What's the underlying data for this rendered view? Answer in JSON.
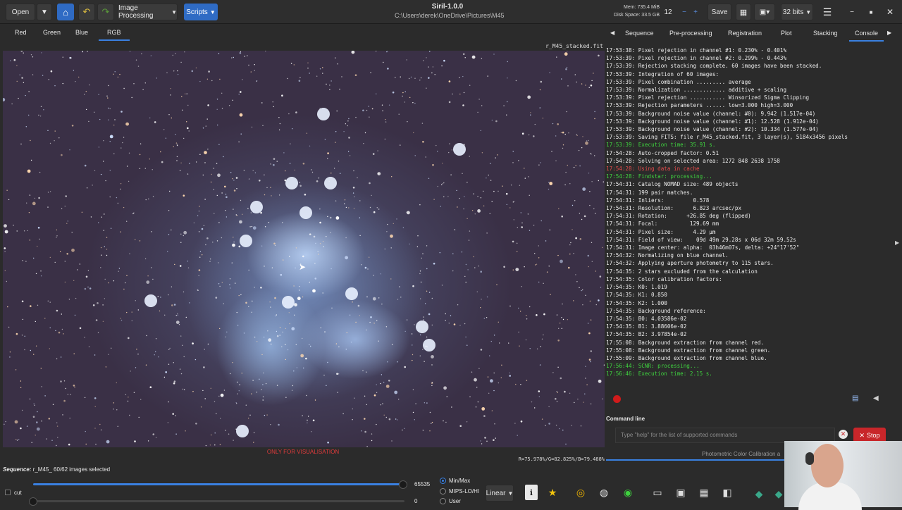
{
  "toolbar": {
    "open_label": "Open",
    "image_processing_label": "Image Processing",
    "scripts_label": "Scripts",
    "app_title": "Siril-1.0.0",
    "file_path": "C:\\Users\\derek\\OneDrive\\Pictures\\M45",
    "mem": "Mem: 735.4 MiB",
    "disk": "Disk Space: 33.5 GB",
    "threads": "12",
    "save_label": "Save",
    "bits_label": "32 bits"
  },
  "channel_tabs": [
    "Red",
    "Green",
    "Blue",
    "RGB"
  ],
  "right_tabs": [
    "Sequence",
    "Pre-processing",
    "Registration",
    "Plot",
    "Stacking",
    "Console"
  ],
  "image": {
    "filename": "r_M45_stacked.fit",
    "visualisation_note": "ONLY FOR VISUALISATION",
    "rgb_readout": "R=75.978%/G=82.825%/B=79.488%"
  },
  "console_lines": [
    {
      "t": "17:53:38: Pixel rejection in channel #1: 0.230% - 0.401%",
      "c": ""
    },
    {
      "t": "17:53:39: Pixel rejection in channel #2: 0.299% - 0.443%",
      "c": ""
    },
    {
      "t": "17:53:39: Rejection stacking complete. 60 images have been stacked.",
      "c": ""
    },
    {
      "t": "17:53:39: Integration of 60 images:",
      "c": ""
    },
    {
      "t": "17:53:39: Pixel combination ......... average",
      "c": ""
    },
    {
      "t": "17:53:39: Normalization ............. additive + scaling",
      "c": ""
    },
    {
      "t": "17:53:39: Pixel rejection ........... Winsorized Sigma Clipping",
      "c": ""
    },
    {
      "t": "17:53:39: Rejection parameters ...... low=3.000 high=3.000",
      "c": ""
    },
    {
      "t": "17:53:39: Background noise value (channel: #0): 9.942 (1.517e-04)",
      "c": ""
    },
    {
      "t": "17:53:39: Background noise value (channel: #1): 12.528 (1.912e-04)",
      "c": ""
    },
    {
      "t": "17:53:39: Background noise value (channel: #2): 10.334 (1.577e-04)",
      "c": ""
    },
    {
      "t": "17:53:39: Saving FITS: file r_M45_stacked.fit, 3 layer(s), 5184x3456 pixels",
      "c": ""
    },
    {
      "t": "17:53:39: Execution time: 35.91 s.",
      "c": "green"
    },
    {
      "t": "17:54:28: Auto-cropped factor: 0.51",
      "c": ""
    },
    {
      "t": "17:54:28: Solving on selected area: 1272 848 2638 1758",
      "c": ""
    },
    {
      "t": "17:54:28: Using data in cache",
      "c": "red"
    },
    {
      "t": "17:54:28: Findstar: processing...",
      "c": "green"
    },
    {
      "t": "17:54:31: Catalog NOMAD size: 489 objects",
      "c": ""
    },
    {
      "t": "17:54:31: 199 pair matches.",
      "c": ""
    },
    {
      "t": "17:54:31: Inliers:         0.578",
      "c": ""
    },
    {
      "t": "17:54:31: Resolution:      6.823 arcsec/px",
      "c": ""
    },
    {
      "t": "17:54:31: Rotation:      +26.85 deg (flipped)",
      "c": ""
    },
    {
      "t": "17:54:31: Focal:          129.69 mm",
      "c": ""
    },
    {
      "t": "17:54:31: Pixel size:      4.29 µm",
      "c": ""
    },
    {
      "t": "17:54:31: Field of view:    09d 49m 29.28s x 06d 32m 59.52s",
      "c": ""
    },
    {
      "t": "17:54:31: Image center: alpha:  03h46m07s, delta: +24°17'52\"",
      "c": ""
    },
    {
      "t": "17:54:32: Normalizing on blue channel.",
      "c": ""
    },
    {
      "t": "17:54:32: Applying aperture photometry to 115 stars.",
      "c": ""
    },
    {
      "t": "17:54:35: 2 stars excluded from the calculation",
      "c": ""
    },
    {
      "t": "17:54:35: Color calibration factors:",
      "c": ""
    },
    {
      "t": "17:54:35: K0: 1.019",
      "c": ""
    },
    {
      "t": "17:54:35: K1: 0.850",
      "c": ""
    },
    {
      "t": "17:54:35: K2: 1.000",
      "c": ""
    },
    {
      "t": "17:54:35: Background reference:",
      "c": ""
    },
    {
      "t": "17:54:35: B0: 4.03586e-02",
      "c": ""
    },
    {
      "t": "17:54:35: B1: 3.88606e-02",
      "c": ""
    },
    {
      "t": "17:54:35: B2: 3.97854e-02",
      "c": ""
    },
    {
      "t": "17:55:08: Background extraction from channel red.",
      "c": ""
    },
    {
      "t": "17:55:08: Background extraction from channel green.",
      "c": ""
    },
    {
      "t": "17:55:09: Background extraction from channel blue.",
      "c": ""
    },
    {
      "t": "17:56:44: SCNR: processing...",
      "c": "green"
    },
    {
      "t": "17:56:46: Execution time: 2.15 s.",
      "c": "green"
    }
  ],
  "command": {
    "label": "Command line",
    "placeholder": "Type \"help\" for the list of supported commands",
    "stop_label": "Stop",
    "status_text": "Photometric Color Calibration a"
  },
  "bottom": {
    "sequence_label": "Sequence:",
    "sequence_value": " r_M45_ 60/62 images selected",
    "cut_label": "cut",
    "hi_value": "65535",
    "lo_value": "0",
    "radio_minmax": "Min/Max",
    "radio_mips": "MIPS-LO/HI",
    "radio_user": "User",
    "stretch_label": "Linear"
  },
  "colors": {
    "accent": "#3a80e0",
    "stop": "#c8262a",
    "console_green": "#3fd33f",
    "console_red": "#e84c4c"
  }
}
